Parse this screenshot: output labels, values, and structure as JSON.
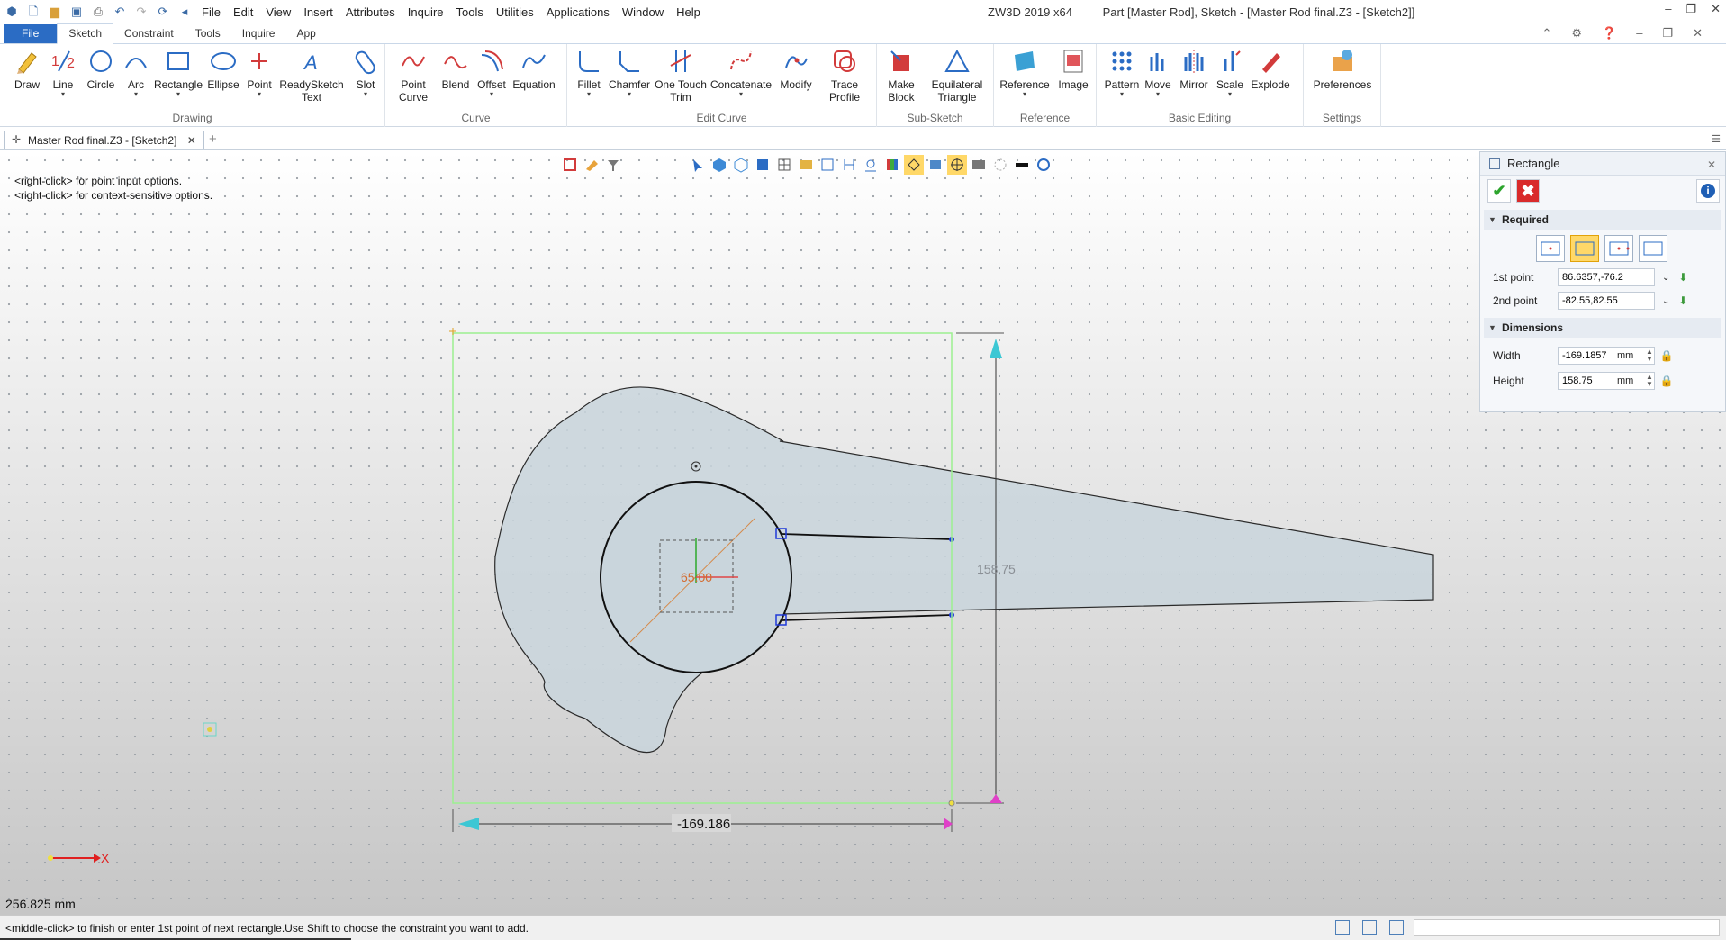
{
  "titlebar": {
    "menus": [
      "File",
      "Edit",
      "View",
      "Insert",
      "Attributes",
      "Inquire",
      "Tools",
      "Utilities",
      "Applications",
      "Window",
      "Help"
    ],
    "app_name": "ZW3D 2019  x64",
    "document_title": "Part [Master Rod],  Sketch - [Master Rod final.Z3 - [Sketch2]]"
  },
  "ribbon_tabs": [
    "File",
    "Sketch",
    "Constraint",
    "Tools",
    "Inquire",
    "App"
  ],
  "ribbon_active_tab": "Sketch",
  "ribbon": {
    "drawing": {
      "name": "Drawing",
      "buttons": [
        "Draw",
        "Line",
        "Circle",
        "Arc",
        "Rectangle",
        "Ellipse",
        "Point",
        "ReadySketch Text",
        "Slot"
      ]
    },
    "curve": {
      "name": "Curve",
      "buttons": [
        "Point Curve",
        "Blend",
        "Offset",
        "Equation"
      ]
    },
    "edit_curve": {
      "name": "Edit Curve",
      "buttons": [
        "Fillet",
        "Chamfer",
        "One Touch Trim",
        "Concatenate",
        "Modify",
        "Trace Profile"
      ]
    },
    "sub_sketch": {
      "name": "Sub-Sketch",
      "buttons": [
        "Make Block",
        "Equilateral Triangle"
      ]
    },
    "reference": {
      "name": "Reference",
      "buttons": [
        "Reference",
        "Image"
      ]
    },
    "basic_editing": {
      "name": "Basic Editing",
      "buttons": [
        "Pattern",
        "Move",
        "Mirror",
        "Scale",
        "Explode"
      ]
    },
    "settings": {
      "name": "Settings",
      "buttons": [
        "Preferences"
      ]
    }
  },
  "doc_tab": {
    "label": "Master Rod final.Z3 - [Sketch2]"
  },
  "canvas": {
    "hint1": "<right-click> for point input options.",
    "hint2": "<right-click> for context-sensitive options.",
    "scale_label": "256.825 mm",
    "dim_width": "-169.186",
    "dim_height": "158.75",
    "dim_circle": "65.00",
    "axis_label": "X"
  },
  "panel": {
    "title": "Rectangle",
    "section_required": "Required",
    "first_point_label": "1st point",
    "first_point_value": "86.6357,-76.2",
    "second_point_label": "2nd point",
    "second_point_value": "-82.55,82.55",
    "section_dimensions": "Dimensions",
    "width_label": "Width",
    "width_value": "-169.1857",
    "height_label": "Height",
    "height_value": "158.75",
    "unit": "mm"
  },
  "statusbar": {
    "message": "<middle-click> to finish or enter 1st point of next rectangle.Use Shift to choose the constraint you want to add."
  },
  "colors": {
    "accent": "#2b6cc4",
    "sketch_fill": "#c9d5dc",
    "preview_rect": "#9cf090",
    "dimension_cyan": "#3cc7d4",
    "dimension_magenta": "#e040c8"
  }
}
